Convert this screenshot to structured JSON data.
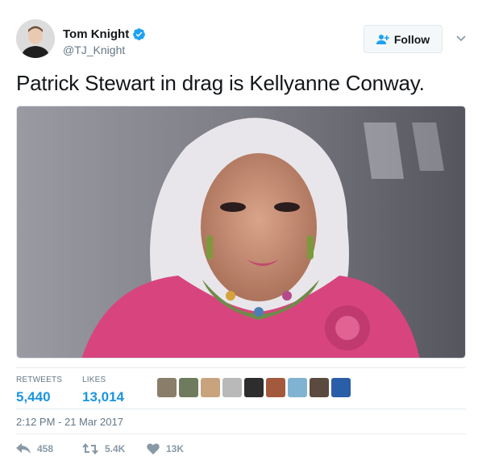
{
  "author": {
    "name": "Tom Knight",
    "handle": "@TJ_Knight",
    "verified": true,
    "avatar_icon": "avatar-photo"
  },
  "follow_button": {
    "label": "Follow",
    "icon": "add-user-icon"
  },
  "tweet": {
    "text": "Patrick Stewart in drag is Kellyanne Conway.",
    "media_description_icon": "photo"
  },
  "stats": {
    "retweets_label": "RETWEETS",
    "retweets_value": "5,440",
    "likes_label": "LIKES",
    "likes_value": "13,014"
  },
  "likers_count_shown": 9,
  "timestamp": "2:12 PM - 21 Mar 2017",
  "actions": {
    "reply_count": "458",
    "retweet_count": "5.4K",
    "like_count": "13K"
  },
  "colors": {
    "accent": "#1b95e0",
    "verified": "#1da1f2",
    "muted": "#657786",
    "action_gray": "#8899a6"
  }
}
